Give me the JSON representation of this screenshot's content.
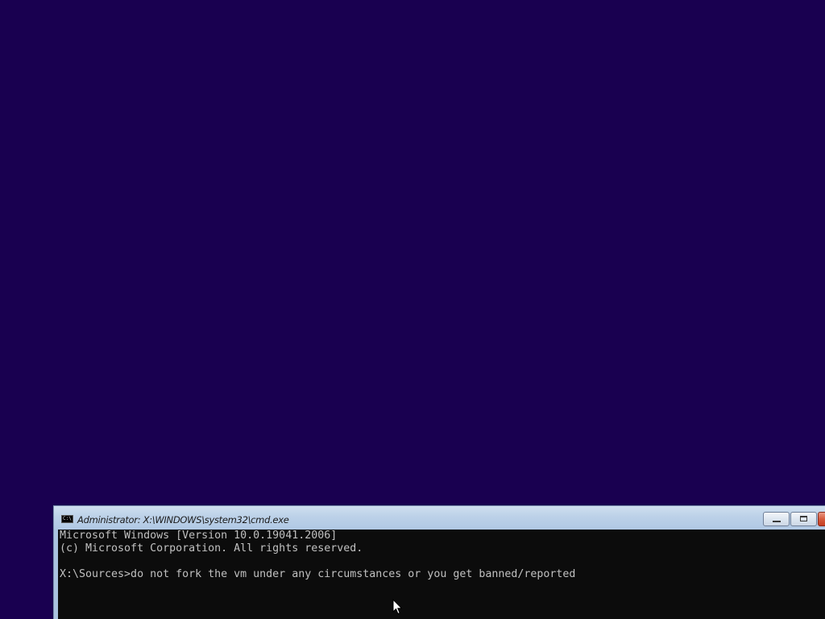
{
  "desktop": {
    "background_color": "#190050"
  },
  "window": {
    "title": "Administrator: X:\\WINDOWS\\system32\\cmd.exe",
    "icon": "cmd-icon",
    "icon_text": "C:\\",
    "controls": {
      "minimize": "minimize-icon",
      "maximize": "maximize-icon",
      "close": "close-icon"
    },
    "close_color": "#c43e23"
  },
  "console": {
    "background_color": "#0c0c0c",
    "text_color": "#c0c0c0",
    "lines": [
      "Microsoft Windows [Version 10.0.19041.2006]",
      "(c) Microsoft Corporation. All rights reserved.",
      "",
      "X:\\Sources>do not fork the vm under any circumstances or you get banned/reported"
    ]
  },
  "pointer": {
    "icon": "mouse-pointer-icon"
  }
}
